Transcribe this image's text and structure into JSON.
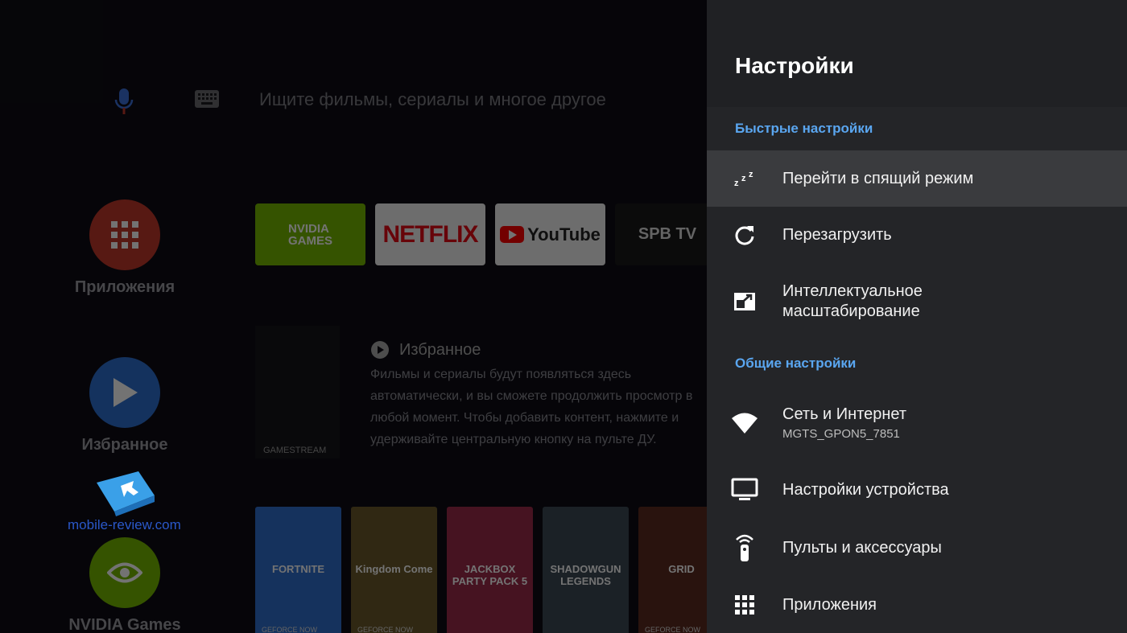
{
  "home": {
    "search_placeholder": "Ищите фильмы, сериалы и многое другое",
    "side_items": [
      {
        "label": "Приложения"
      },
      {
        "label": "Избранное"
      },
      {
        "label": "NVIDIA Games"
      }
    ],
    "app_tiles": [
      {
        "label_line1": "NVIDIA",
        "label_line2": "GAMES"
      },
      {
        "label": "NETFLIX"
      },
      {
        "label": "YouTube"
      },
      {
        "label": "SPB TV"
      }
    ],
    "gamestream_label": "GAMESTREAM",
    "favorites_title": "Избранное",
    "favorites_description": "Фильмы и сериалы будут появляться здесь автоматически, и вы сможете продолжить просмотр в любой момент. Чтобы добавить контент, нажмите и удерживайте центральную кнопку на пульте ДУ.",
    "games": [
      {
        "name": "FORTNITE",
        "tag": "GEFORCE NOW",
        "color": "#2f6fcf"
      },
      {
        "name": "Kingdom Come",
        "tag": "GEFORCE NOW",
        "color": "#6a5a2a"
      },
      {
        "name": "JACKBOX PARTY PACK 5",
        "tag": "",
        "color": "#9c2a4a"
      },
      {
        "name": "SHADOWGUN LEGENDS",
        "tag": "",
        "color": "#3d4a55"
      },
      {
        "name": "GRID",
        "tag": "GEFORCE NOW",
        "color": "#5b2a20"
      }
    ],
    "watermark": "mobile-review.com"
  },
  "settings": {
    "title": "Настройки",
    "quick_section": "Быстрые настройки",
    "quick_items": [
      {
        "label": "Перейти в спящий режим",
        "icon": "sleep-icon"
      },
      {
        "label": "Перезагрузить",
        "icon": "restart-icon"
      },
      {
        "label_line1": "Интеллектуальное",
        "label_line2": "масштабирование",
        "icon": "upscale-icon"
      }
    ],
    "general_section": "Общие настройки",
    "general_items": [
      {
        "label": "Сеть и Интернет",
        "sub": "MGTS_GPON5_7851",
        "icon": "wifi-icon"
      },
      {
        "label": "Настройки устройства",
        "icon": "tv-icon"
      },
      {
        "label": "Пульты и аксессуары",
        "icon": "remote-icon"
      },
      {
        "label": "Приложения",
        "icon": "apps-grid-icon"
      }
    ]
  },
  "colors": {
    "accent": "#5aa6f0",
    "panel_bg": "#242528",
    "focus_bg": "#3a3b3e"
  }
}
